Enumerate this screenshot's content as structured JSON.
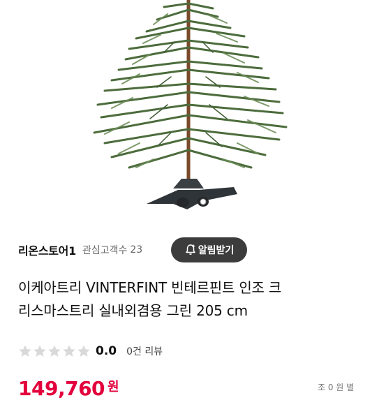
{
  "store": {
    "name": "리온스토어1",
    "follow_label": "관심고객수",
    "follow_count": "23",
    "alert_button": "알림받기"
  },
  "product": {
    "title_line1": "이케아트리 VINTERFINT 빈테르핀트 인조 크",
    "title_line2": "리스마스트리 실내외겸용 그린 205 cm"
  },
  "rating": {
    "score": "0.0",
    "review_count": "0건 리뷰",
    "stars_filled": 0,
    "stars_total": 5
  },
  "price": {
    "amount": "149,760",
    "currency": "원",
    "meta": "조 0 원 별"
  },
  "colors": {
    "price": "#e3003c",
    "button_bg": "#3c3c3c",
    "star_empty": "#d9d9d9"
  },
  "icons": {
    "bell": "bell-plus-icon",
    "star": "star-icon"
  }
}
